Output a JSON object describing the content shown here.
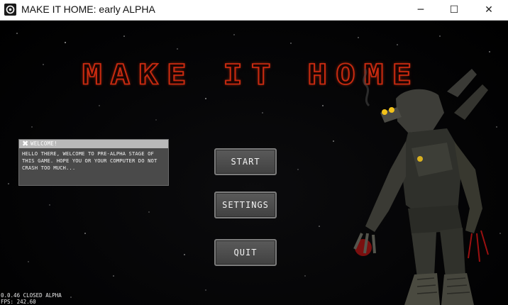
{
  "window": {
    "title": "MAKE IT HOME: early ALPHA",
    "minimize_glyph": "─",
    "maximize_glyph": "☐",
    "close_glyph": "✕"
  },
  "game": {
    "logo_text": "MAKE IT HOME",
    "welcome": {
      "close_glyph": "✖",
      "title": "WELCOME!",
      "body": "HELLO THERE, WELCOME TO PRE-ALPHA STAGE OF THIS GAME. HOPE YOU OR YOUR COMPUTER DO NOT CRASH TOO MUCH..."
    },
    "menu": {
      "start": "START",
      "settings": "SETTINGS",
      "quit": "QUIT"
    },
    "footer": {
      "version": "0.0.46 CLOSED ALPHA",
      "fps": "FPS: 242.60"
    }
  },
  "colors": {
    "logo_red": "#c82a10",
    "button_face": "#4d4d4d",
    "panel_bg": "#4a4a4a"
  },
  "icons": [
    "app-icon",
    "close-icon"
  ]
}
